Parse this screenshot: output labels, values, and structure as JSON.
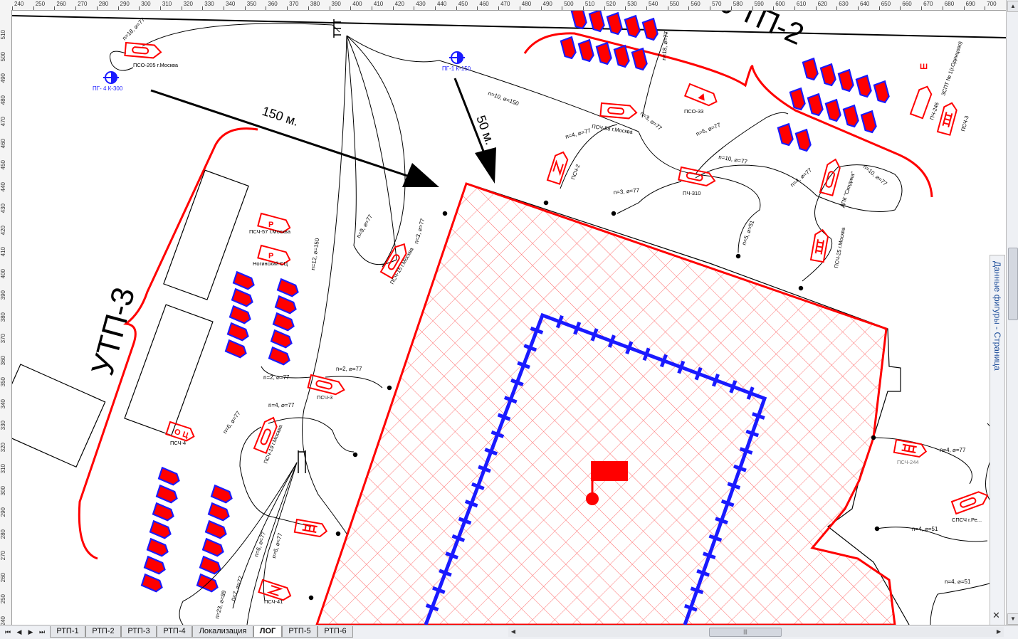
{
  "ruler": {
    "top_ticks": [
      "240",
      "250",
      "260",
      "270",
      "280",
      "290",
      "300",
      "310",
      "320",
      "330",
      "340",
      "350",
      "360",
      "370",
      "380",
      "390",
      "400",
      "410",
      "420",
      "430",
      "440",
      "450",
      "460",
      "470",
      "480",
      "490",
      "500",
      "510",
      "520",
      "530",
      "540",
      "550",
      "560",
      "570",
      "580",
      "590",
      "600",
      "610",
      "620",
      "630",
      "640",
      "650",
      "660",
      "670",
      "680",
      "690",
      "700"
    ],
    "left_ticks": [
      "510",
      "500",
      "490",
      "480",
      "470",
      "460",
      "450",
      "440",
      "430",
      "420",
      "410",
      "400",
      "390",
      "380",
      "370",
      "360",
      "350",
      "340",
      "330",
      "320",
      "310",
      "300",
      "290",
      "280",
      "270",
      "260",
      "250",
      "240"
    ]
  },
  "drawing": {
    "sector_labels": {
      "utp2": "УТП-2",
      "utp3": "УТП-3"
    },
    "distances": {
      "d150": "150 м.",
      "d50": "50 м."
    },
    "hydrants": [
      {
        "label": "ПГ-1  К-150"
      },
      {
        "label": "ПГ- 4  К-300"
      }
    ],
    "units": {
      "pso205": "ПСО-205 г.Москва",
      "psch58": "ПСЧ-58 г.Москва",
      "pso33": "ПСО-33",
      "psch2": "ПСЧ-2",
      "pch310": "ПЧ-310",
      "dpk": "ДПК \"Синдика\"",
      "pch246": "ПЧ-246",
      "zspt": "ЗСПТ № 1(г.Одинцово)",
      "psch3r": "ПСЧ-3",
      "psch25": "ПСЧ-25 г.Москва",
      "psch57": "ПСЧ-57 г.Москва",
      "noginsk": "Ногинский СЦ",
      "psch15": "ПСЧ-15 г.Москва",
      "psch3": "ПСЧ-3",
      "psch4": "ПСЧ-4",
      "psch19": "ПСЧ-19 г.Москва",
      "psch41": "ПСЧ-41",
      "psch244": "ПСЧ-244",
      "spsch": "СПСЧ г.Ре..."
    },
    "hose_labels": {
      "h1": "n=18, ⌀=77",
      "h2": "n=18, ⌀=77",
      "h3": "n=10, ⌀=150",
      "h4": "n=4, ⌀=77",
      "h5": "n=3, ⌀=77",
      "h6": "n=5, ⌀=77",
      "h7": "n=10, ⌀=77",
      "h8": "n=4, ⌀=77",
      "h9": "n=10, ⌀=77",
      "h10": "n=3, ⌀=77",
      "h11": "n=5, ⌀=51",
      "h12": "n=9, ⌀=77",
      "h13": "n=3, ⌀=77",
      "h14": "n=12, ⌀=150",
      "h15": "n=2, ⌀=77",
      "h16": "n=2, ⌀=77",
      "h17": "n=4, ⌀=77",
      "h18": "n=6, ⌀=77",
      "h19": "n=6, ⌀=77",
      "h20": "n=6, ⌀=77",
      "h21": "n=7, ⌀=77",
      "h22": "n=23, ⌀=89",
      "h23": "n=4, ⌀=77",
      "h24": "n=4, ⌀=51",
      "h25": "n=4, ⌀=51"
    },
    "letters": {
      "r": "Р",
      "sh": "Ш"
    }
  },
  "side_panel": {
    "title": "Данные фигуры - Страница",
    "close": "✕"
  },
  "tabs": [
    {
      "label": "РТП-1",
      "active": false
    },
    {
      "label": "РТП-2",
      "active": false
    },
    {
      "label": "РТП-3",
      "active": false
    },
    {
      "label": "РТП-4",
      "active": false
    },
    {
      "label": "Локализация",
      "active": false
    },
    {
      "label": "ЛОГ",
      "active": true
    },
    {
      "label": "РТП-5",
      "active": false
    },
    {
      "label": "РТП-6",
      "active": false
    }
  ],
  "nav": {
    "first": "⏮",
    "prev": "◀",
    "next": "▶",
    "last": "⏭"
  },
  "colors": {
    "red": "#ff0000",
    "blue": "#1a1aff",
    "hatch": "#ff6666"
  }
}
